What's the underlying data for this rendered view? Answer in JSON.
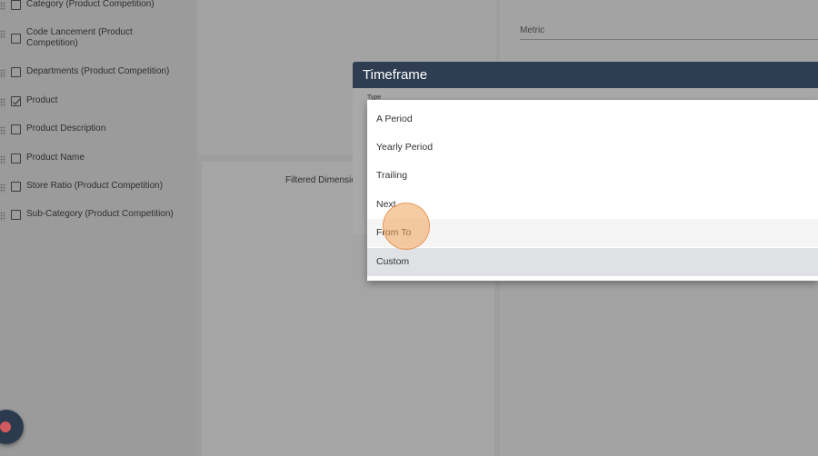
{
  "dimensions": {
    "items": [
      {
        "label": "Category (Product Competition)",
        "checked": false
      },
      {
        "label": "Code Lancement (Product Competition)",
        "checked": false
      },
      {
        "label": "Departments (Product Competition)",
        "checked": false
      },
      {
        "label": "Product",
        "checked": true
      },
      {
        "label": "Product Description",
        "checked": false
      },
      {
        "label": "Product Name",
        "checked": false
      },
      {
        "label": "Store Ratio (Product Competition)",
        "checked": false
      },
      {
        "label": "Sub-Category (Product Competition)",
        "checked": false
      }
    ]
  },
  "metric": {
    "label": "Metric"
  },
  "filtered": {
    "label": "Filtered Dimensio"
  },
  "dialog": {
    "title": "Timeframe",
    "type_label": "Type",
    "options": [
      {
        "label": "A Period"
      },
      {
        "label": "Yearly Period"
      },
      {
        "label": "Trailing"
      },
      {
        "label": "Next"
      },
      {
        "label": "From To"
      },
      {
        "label": "Custom"
      }
    ],
    "hovered_option": "From To",
    "selected_option": "Custom"
  },
  "colors": {
    "header_bg": "#2e3d51",
    "fab_bg": "#2c3a4e",
    "fab_dot": "#d05a5f",
    "cursor_ring": "#f0a05a"
  }
}
